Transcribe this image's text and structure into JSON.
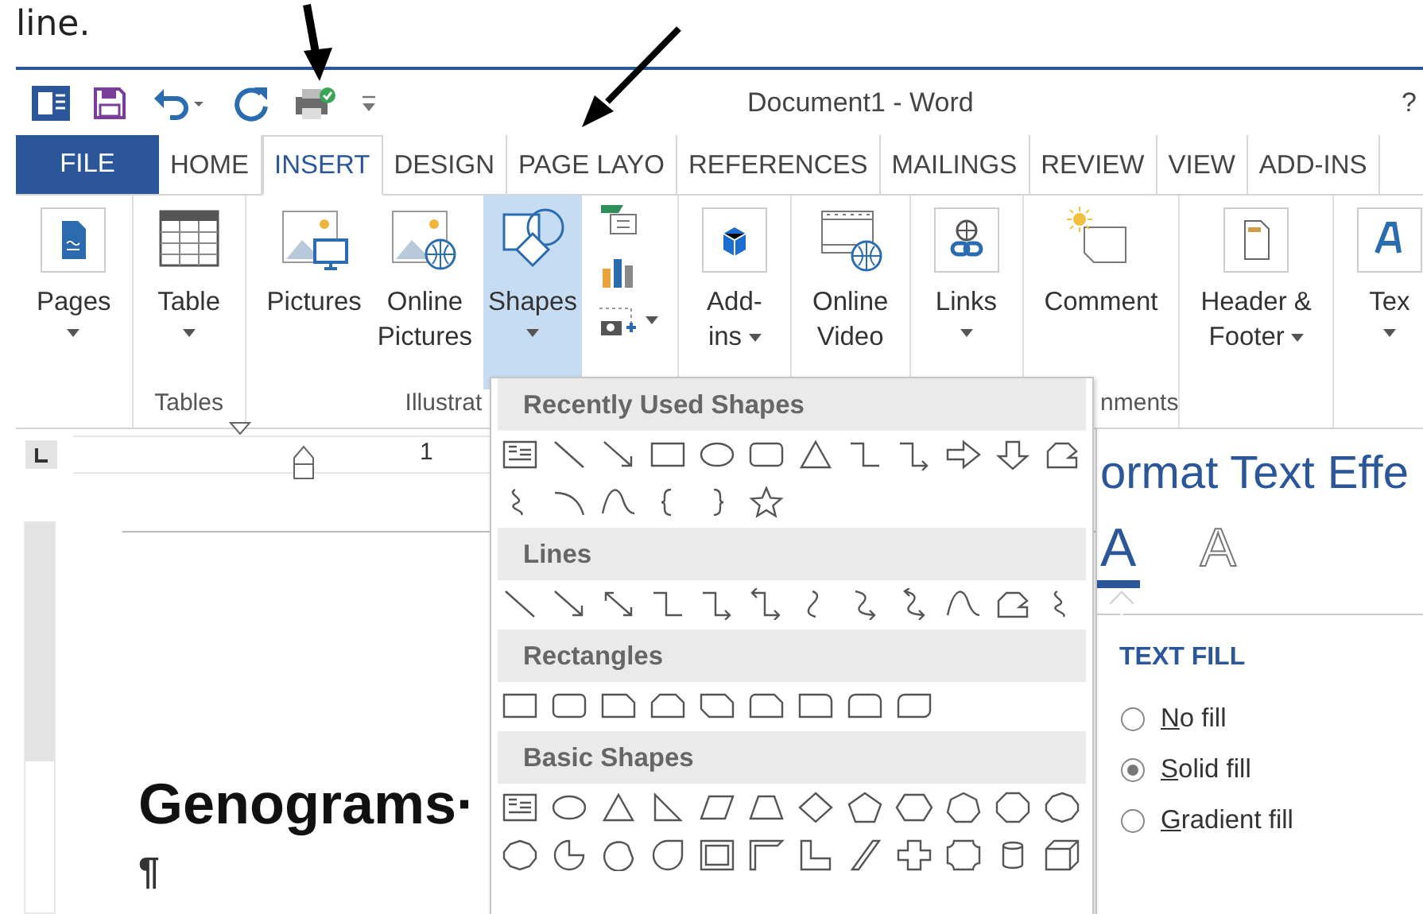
{
  "caption": "line.",
  "window": {
    "title": "Document1 - Word",
    "help": "?"
  },
  "tabs": [
    {
      "label": "FILE",
      "kind": "file",
      "selected": false
    },
    {
      "label": "HOME",
      "kind": "tab",
      "selected": false
    },
    {
      "label": "INSERT",
      "kind": "tab",
      "selected": true
    },
    {
      "label": "DESIGN",
      "kind": "tab",
      "selected": false
    },
    {
      "label": "PAGE LAYO",
      "kind": "tab",
      "selected": false
    },
    {
      "label": "REFERENCES",
      "kind": "tab",
      "selected": false
    },
    {
      "label": "MAILINGS",
      "kind": "tab",
      "selected": false
    },
    {
      "label": "REVIEW",
      "kind": "tab",
      "selected": false
    },
    {
      "label": "VIEW",
      "kind": "tab",
      "selected": false
    },
    {
      "label": "ADD-INS",
      "kind": "tab",
      "selected": false
    }
  ],
  "ribbon": [
    {
      "items": [
        {
          "kind": "large",
          "lines": [
            "Pages"
          ],
          "caret": true,
          "expanded": false
        }
      ]
    },
    {
      "label": "Tables",
      "items": [
        {
          "kind": "large",
          "lines": [
            "Table"
          ],
          "caret": true,
          "expanded": false
        }
      ]
    },
    {
      "label": "Illustrat",
      "items": [
        {
          "kind": "large",
          "lines": [
            "Pictures"
          ],
          "expanded": false
        },
        {
          "kind": "large",
          "lines": [
            "Online",
            "Pictures"
          ],
          "expanded": false
        },
        {
          "kind": "large",
          "lines": [
            "Shapes"
          ],
          "caret": true,
          "expanded": true
        },
        {
          "kind": "stack",
          "expanded": false
        }
      ]
    },
    {
      "items": [
        {
          "kind": "large",
          "lines": [
            "Add-",
            "ins"
          ],
          "caret_inline": true,
          "expanded": false
        }
      ]
    },
    {
      "items": [
        {
          "kind": "large",
          "lines": [
            "Online",
            "Video"
          ],
          "expanded": false
        }
      ]
    },
    {
      "items": [
        {
          "kind": "large",
          "lines": [
            "Links"
          ],
          "caret": true,
          "expanded": false
        }
      ]
    },
    {
      "label": "nments",
      "items": [
        {
          "kind": "large",
          "lines": [
            "Comment"
          ],
          "expanded": false
        }
      ]
    },
    {
      "items": [
        {
          "kind": "large",
          "lines": [
            "Header &",
            "Footer"
          ],
          "caret_inline": true,
          "expanded": false
        }
      ]
    },
    {
      "items": [
        {
          "kind": "large",
          "lines": [
            "Tex"
          ],
          "caret": true,
          "expanded": false
        }
      ]
    }
  ],
  "ruler": {
    "number": "1"
  },
  "document": {
    "heading": "Genograms·",
    "pilcrow": "¶"
  },
  "shapes_menu": {
    "sections": [
      {
        "title": "Recently Used Shapes"
      },
      {
        "title": "Lines"
      },
      {
        "title": "Rectangles"
      },
      {
        "title": "Basic Shapes"
      }
    ]
  },
  "pane": {
    "title": "ormat Text Effe",
    "tabs": [
      {
        "label": "A",
        "kind": "fill",
        "selected": true
      },
      {
        "label": "A",
        "kind": "outline",
        "selected": false
      }
    ],
    "section": "TEXT FILL",
    "options": [
      {
        "label": "No fill",
        "selected": false
      },
      {
        "label": "Solid fill",
        "selected": true
      },
      {
        "label": "Gradient fill",
        "selected": false
      }
    ]
  }
}
